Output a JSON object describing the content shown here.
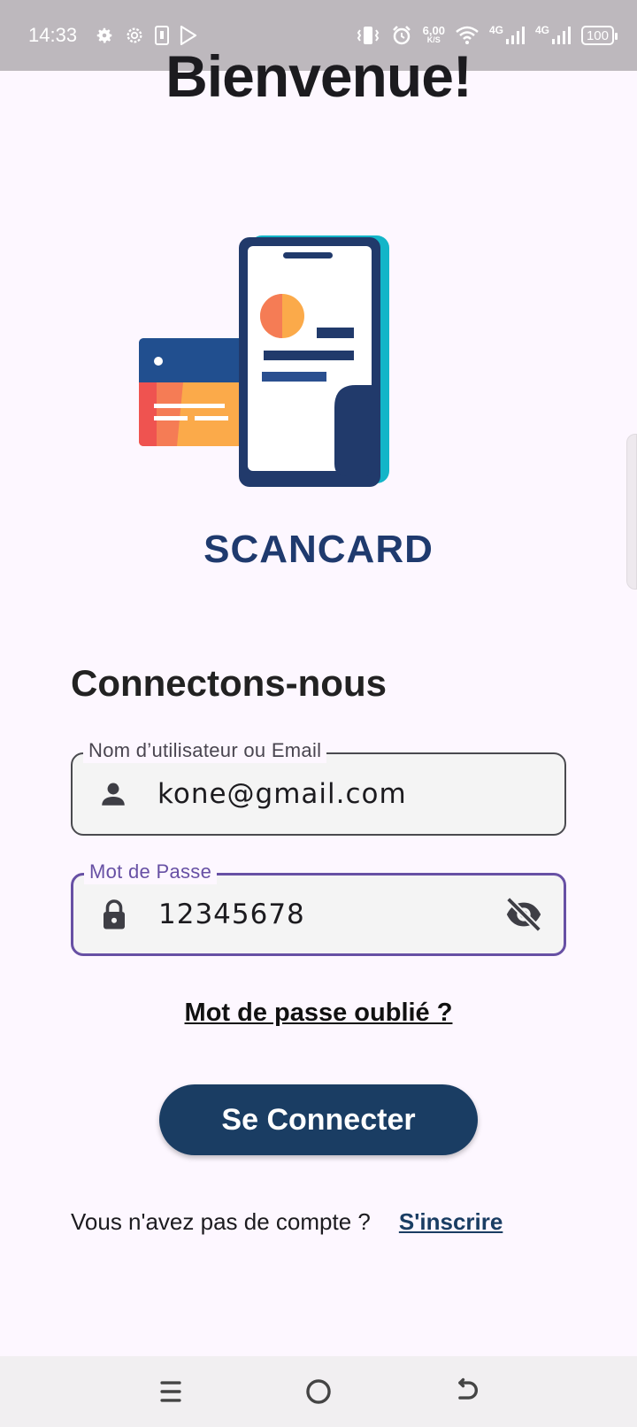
{
  "status_bar": {
    "time": "14:33",
    "speed_value": "6,00",
    "speed_unit": "K/S",
    "network_1": "4G",
    "network_2": "4G",
    "battery": "100",
    "icons": [
      "settings-icon",
      "settings-outline-icon",
      "sim-card-icon",
      "play-store-icon",
      "vibrate-icon",
      "alarm-icon",
      "wifi-icon",
      "signal-icon",
      "battery-icon"
    ]
  },
  "header": {
    "title": "Bienvenue!"
  },
  "logo": {
    "brand_text": "SCANCARD"
  },
  "login": {
    "section_title": "Connectons-nous",
    "username_label": "Nom d’utilisateur ou Email",
    "username_value": "kone@gmail.com",
    "password_label": "Mot de Passe",
    "password_value": "12345678",
    "forgot_link": "Mot de passe oublié ?",
    "submit_label": "Se Connecter",
    "signup_prompt": "Vous n'avez pas de compte ?",
    "signup_link": "S'inscrire"
  },
  "colors": {
    "background": "#fdf7ff",
    "primary": "#1a3d63",
    "focus": "#6750a4",
    "brand": "#1f3a6e"
  }
}
